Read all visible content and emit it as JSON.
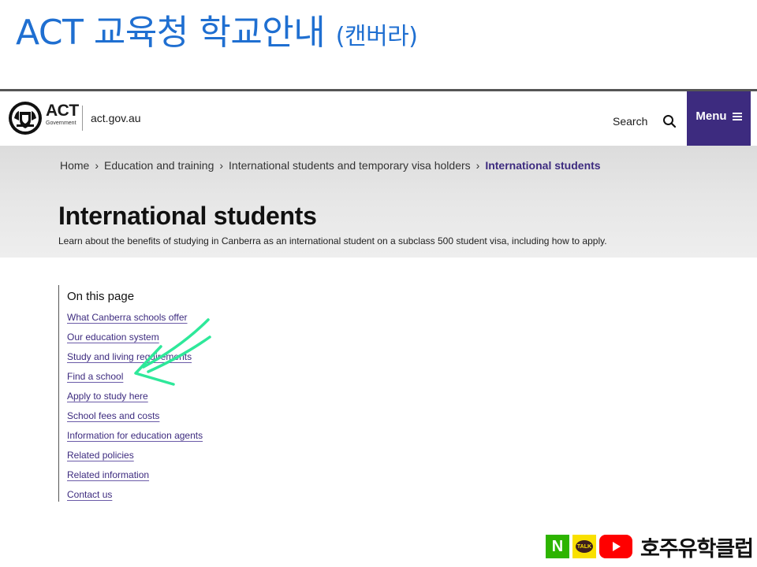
{
  "slide": {
    "title": "ACT 교육청 학교안내",
    "subtitle": "(캔버라)"
  },
  "site": {
    "logo_text": "ACT",
    "logo_subtext": "Government",
    "domain": "act.gov.au",
    "search_label": "Search",
    "menu_label": "Menu",
    "accent_color": "#3d2b7f",
    "icons": [
      "act-crest-icon",
      "search-icon",
      "hamburger-icon"
    ]
  },
  "breadcrumb": {
    "items": [
      "Home",
      "Education and training",
      "International students and temporary visa holders"
    ],
    "current": "International students",
    "separator": "›"
  },
  "page": {
    "title": "International students",
    "intro": "Learn about the benefits of studying in Canberra as an international student on a subclass 500 student visa, including how to apply."
  },
  "toc": {
    "heading": "On this page",
    "links": [
      "What Canberra schools offer",
      "Our education system",
      "Study and living requirements",
      "Find a school",
      "Apply to study here",
      "School fees and costs",
      "Information for education agents",
      "Related policies",
      "Related information",
      "Contact us"
    ]
  },
  "annotation": {
    "arrow_color": "#2ee89a",
    "points_to": "Find a school"
  },
  "footer": {
    "badge_n": "N",
    "badge_talk": "TALK",
    "brand_text": "호주유학클럽",
    "colors": {
      "naver": "#2db400",
      "kakao": "#f9e000",
      "youtube": "#ff0000"
    }
  }
}
